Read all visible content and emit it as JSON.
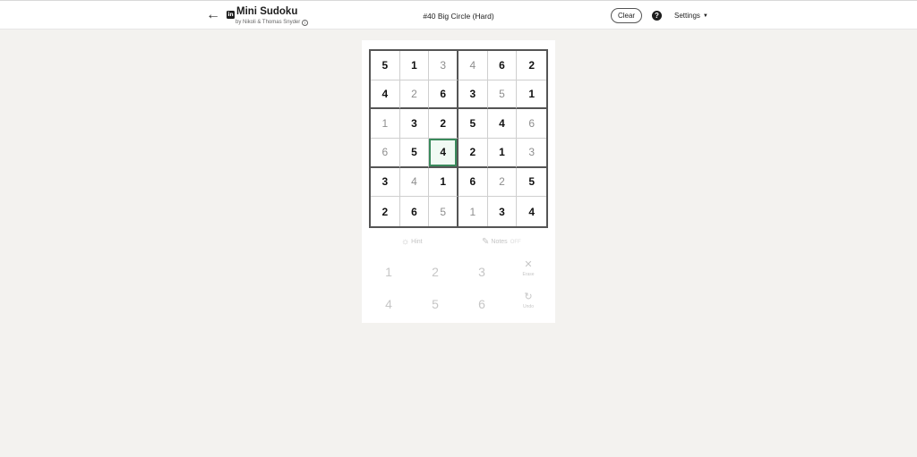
{
  "header": {
    "back_icon": "arrow-left-icon",
    "logo_text": "in",
    "app_title": "Mini Sudoku",
    "byline": "by Nikoli & Thomas Snyder",
    "puzzle_title": "#40 Big Circle (Hard)",
    "clear_label": "Clear",
    "help_label": "?",
    "settings_label": "Settings"
  },
  "board": {
    "rows": [
      [
        {
          "v": "5",
          "t": "given"
        },
        {
          "v": "1",
          "t": "given"
        },
        {
          "v": "3",
          "t": "entered"
        },
        {
          "v": "4",
          "t": "entered"
        },
        {
          "v": "6",
          "t": "given"
        },
        {
          "v": "2",
          "t": "given"
        }
      ],
      [
        {
          "v": "4",
          "t": "given"
        },
        {
          "v": "2",
          "t": "entered"
        },
        {
          "v": "6",
          "t": "given"
        },
        {
          "v": "3",
          "t": "given"
        },
        {
          "v": "5",
          "t": "entered"
        },
        {
          "v": "1",
          "t": "given"
        }
      ],
      [
        {
          "v": "1",
          "t": "entered"
        },
        {
          "v": "3",
          "t": "given"
        },
        {
          "v": "2",
          "t": "given"
        },
        {
          "v": "5",
          "t": "given"
        },
        {
          "v": "4",
          "t": "given"
        },
        {
          "v": "6",
          "t": "entered"
        }
      ],
      [
        {
          "v": "6",
          "t": "entered"
        },
        {
          "v": "5",
          "t": "given"
        },
        {
          "v": "4",
          "t": "given"
        },
        {
          "v": "2",
          "t": "given"
        },
        {
          "v": "1",
          "t": "given"
        },
        {
          "v": "3",
          "t": "entered"
        }
      ],
      [
        {
          "v": "3",
          "t": "given"
        },
        {
          "v": "4",
          "t": "entered"
        },
        {
          "v": "1",
          "t": "given"
        },
        {
          "v": "6",
          "t": "given"
        },
        {
          "v": "2",
          "t": "entered"
        },
        {
          "v": "5",
          "t": "given"
        }
      ],
      [
        {
          "v": "2",
          "t": "given"
        },
        {
          "v": "6",
          "t": "given"
        },
        {
          "v": "5",
          "t": "entered"
        },
        {
          "v": "1",
          "t": "entered"
        },
        {
          "v": "3",
          "t": "given"
        },
        {
          "v": "4",
          "t": "given"
        }
      ]
    ],
    "selected": [
      3,
      2
    ],
    "colors": {
      "selected_border": "#3a8a5c",
      "given": "#111111",
      "entered": "#8e8e8e"
    }
  },
  "tools": {
    "hint_label": "Hint",
    "hint_icon": "lightbulb-icon",
    "notes_label": "Notes",
    "notes_icon": "pencil-icon",
    "notes_state": "OFF"
  },
  "keypad": {
    "keys": [
      "1",
      "2",
      "3",
      "4",
      "5",
      "6"
    ],
    "erase_label": "Erase",
    "erase_icon": "close-icon",
    "undo_label": "Undo",
    "undo_icon": "undo-icon"
  }
}
